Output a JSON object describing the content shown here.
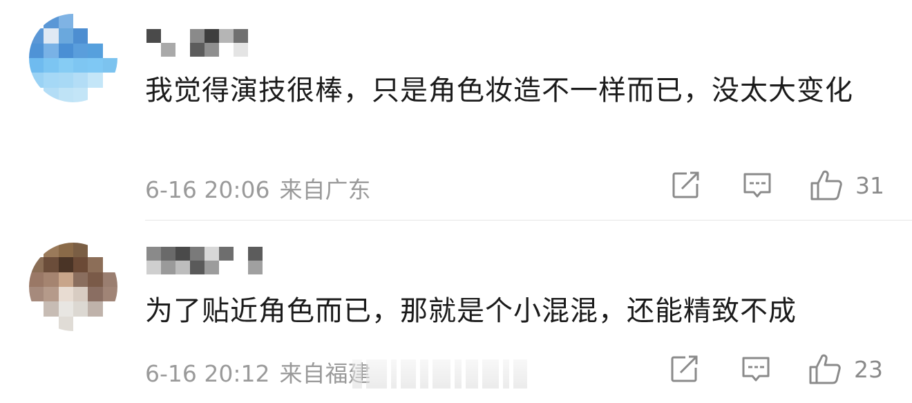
{
  "comments": [
    {
      "text": "我觉得演技很棒，只是角色妆造不一样而已，没太大变化",
      "time": "6-16 20:06",
      "location": "来自广东",
      "likes": "31",
      "icons": {
        "repost": "repost-icon",
        "reply": "comment-icon",
        "like": "thumbs-up-icon"
      },
      "avatar_colors": [
        "#ffffff",
        "#5a97d6",
        "#7fb3e4",
        "#ffffff",
        "#ffffff",
        "#ffffff",
        "#5a97d6",
        "#dfe9f4",
        "#6aa8dd",
        "#4d8ed1",
        "#ffffff",
        "#ffffff",
        "#4f93d6",
        "#79b2e6",
        "#4a8fd4",
        "#5a9edc",
        "#56a0dd",
        "#ffffff",
        "#6fbbef",
        "#7cc5f2",
        "#86ccf4",
        "#7ec6f2",
        "#7fc8f4",
        "#7cc3ef",
        "#9ad2f4",
        "#a5d8f6",
        "#a8d9f5",
        "#b3ddf6",
        "#c4e6f8",
        "#ffffff",
        "#ffffff",
        "#b3ddf6",
        "#bfe3f6",
        "#c3e5f7",
        "#ffffff",
        "#ffffff"
      ],
      "name_colors": [
        "#4a4a4a",
        "#ffffff",
        "#ffffff",
        "#a9a9a9",
        "#ffffff",
        "#ffffff",
        "#8a8a8a",
        "#5c5c5c",
        "#3e3e3e",
        "#8f8f8f",
        "#b5b5b5",
        "#ffffff",
        "#707070",
        "#e4e4e4"
      ]
    },
    {
      "text": "为了贴近角色而已，那就是个小混混，还能精致不成",
      "time": "6-16 20:12",
      "location": "来自福建",
      "likes": "23",
      "icons": {
        "repost": "repost-icon",
        "reply": "comment-icon",
        "like": "thumbs-up-icon"
      },
      "avatar_colors": [
        "#ffffff",
        "#9a7a5a",
        "#8a6a48",
        "#7a5e44",
        "#ffffff",
        "#ffffff",
        "#8a6d55",
        "#6b4d3a",
        "#4a3426",
        "#6b4a36",
        "#8c6e58",
        "#ffffff",
        "#9a7866",
        "#a58470",
        "#c8a58a",
        "#8a6e5e",
        "#7a5a48",
        "#9a7e70",
        "#a68a7c",
        "#b59a8a",
        "#e8dcd2",
        "#d8ccc2",
        "#8a6e62",
        "#a08476",
        "#ffffff",
        "#c7bcb4",
        "#e8e6e2",
        "#dcd8d2",
        "#bfb2aa",
        "#ffffff",
        "#ffffff",
        "#ffffff",
        "#e0dcd6",
        "#ffffff",
        "#ffffff",
        "#ffffff"
      ],
      "name_colors": [
        "#8a8a8a",
        "#cfcfcf",
        "#6a6a6a",
        "#9a9a9a",
        "#4a4a4a",
        "#bdbdbd",
        "#7a7a7a",
        "#5a5a5a",
        "#d8d8d8",
        "#9c9c9c",
        "#6e6e6e",
        "#ffffff",
        "#ffffff",
        "#ffffff",
        "#5c5c5c",
        "#a0a0a0"
      ]
    }
  ]
}
